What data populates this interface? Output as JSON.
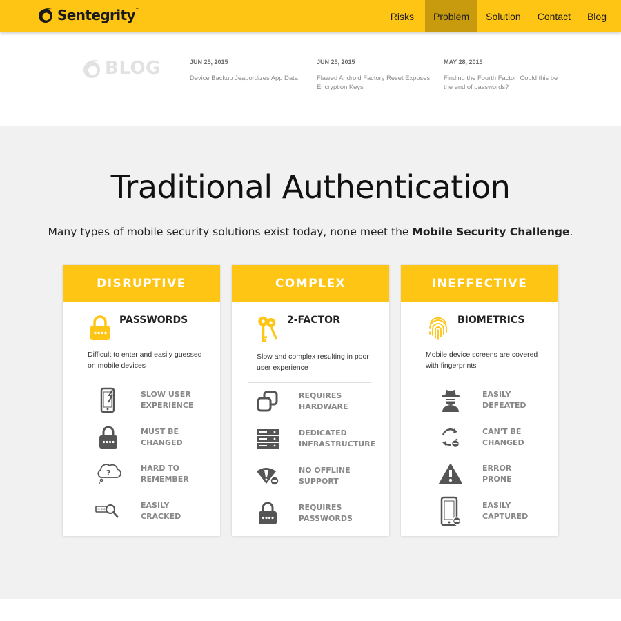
{
  "header": {
    "brand": "Sentegrity",
    "brand_tm": "™",
    "nav": [
      {
        "label": "Risks",
        "active": false
      },
      {
        "label": "Problem",
        "active": true
      },
      {
        "label": "Solution",
        "active": false
      },
      {
        "label": "Contact",
        "active": false
      },
      {
        "label": "Blog",
        "active": false
      }
    ]
  },
  "blog": {
    "label": "BLOG",
    "posts": [
      {
        "date": "JUN 25, 2015",
        "title": "Device Backup Jeapordizes App Data"
      },
      {
        "date": "JUN 25, 2015",
        "title": "Flawed Android Factory Reset Exposes Encryption Keys"
      },
      {
        "date": "MAY 28, 2015",
        "title": "Finding the Fourth Factor: Could this be the end of passwords?"
      }
    ]
  },
  "main": {
    "headline": "Traditional Authentication",
    "subline_pre": "Many types of mobile security solutions exist today, none meet the ",
    "subline_bold": "Mobile Security Challenge",
    "subline_post": ".",
    "cards": [
      {
        "header": "DISRUPTIVE",
        "title": "PASSWORDS",
        "icon": "padlock-icon",
        "description": "Difficult to enter and easily guessed on mobile devices",
        "features": [
          {
            "icon": "broken-phone-icon",
            "label": "SLOW USER\nEXPERIENCE"
          },
          {
            "icon": "padlock-icon",
            "label": "MUST BE\nCHANGED"
          },
          {
            "icon": "thought-question-icon",
            "label": "HARD TO\nREMEMBER"
          },
          {
            "icon": "password-magnifier-icon",
            "label": "EASILY\nCRACKED"
          }
        ]
      },
      {
        "header": "COMPLEX",
        "title": "2-FACTOR",
        "icon": "keys-icon",
        "description": "Slow and complex resulting in poor user experience",
        "features": [
          {
            "icon": "hardware-token-icon",
            "label": "REQUIRES\nHARDWARE"
          },
          {
            "icon": "server-icon",
            "label": "DEDICATED\nINFRASTRUCTURE"
          },
          {
            "icon": "no-signal-icon",
            "label": "NO OFFLINE\nSUPPORT"
          },
          {
            "icon": "padlock-icon",
            "label": "REQUIRES\nPASSWORDS"
          }
        ]
      },
      {
        "header": "INEFFECTIVE",
        "title": "BIOMETRICS",
        "icon": "fingerprint-icon",
        "description": "Mobile device screens are covered with fingerprints",
        "features": [
          {
            "icon": "spy-icon",
            "label": "EASILY\nDEFEATED"
          },
          {
            "icon": "refresh-blocked-icon",
            "label": "CAN'T BE\nCHANGED"
          },
          {
            "icon": "warning-icon",
            "label": "ERROR\nPRONE"
          },
          {
            "icon": "phone-blocked-icon",
            "label": "EASILY\nCAPTURED"
          }
        ]
      }
    ]
  },
  "colors": {
    "accent": "#fec514",
    "active_nav": "#c89b0f",
    "icon_gray": "#555555"
  }
}
